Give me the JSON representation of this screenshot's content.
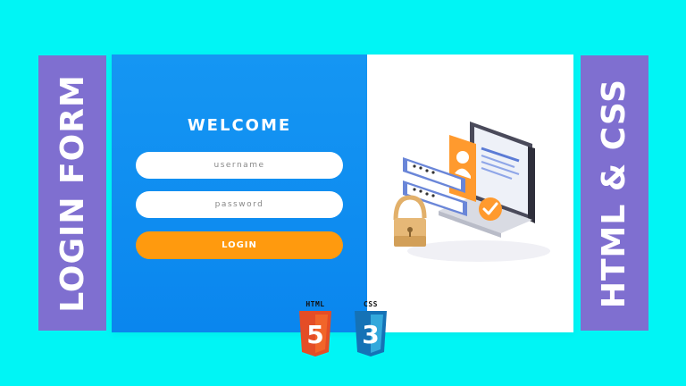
{
  "banners": {
    "left_text": "LOGIN FORM",
    "right_text": "HTML & CSS"
  },
  "form": {
    "title": "WELCOME",
    "username_placeholder": "username",
    "password_placeholder": "password",
    "login_label": "LOGIN"
  },
  "badges": {
    "html_label": "HTML",
    "html_digit": "5",
    "css_label": "CSS",
    "css_digit": "3"
  },
  "colors": {
    "background": "#00f5f5",
    "banner": "#7f6fd0",
    "panel_blue": "#0a86ee",
    "button_orange": "#ff9a0e",
    "html5_orange": "#e44d26",
    "css3_blue": "#1572b6"
  },
  "icons": [
    "padlock-icon",
    "monitor-icon",
    "check-icon",
    "html5-logo-icon",
    "css3-logo-icon"
  ]
}
